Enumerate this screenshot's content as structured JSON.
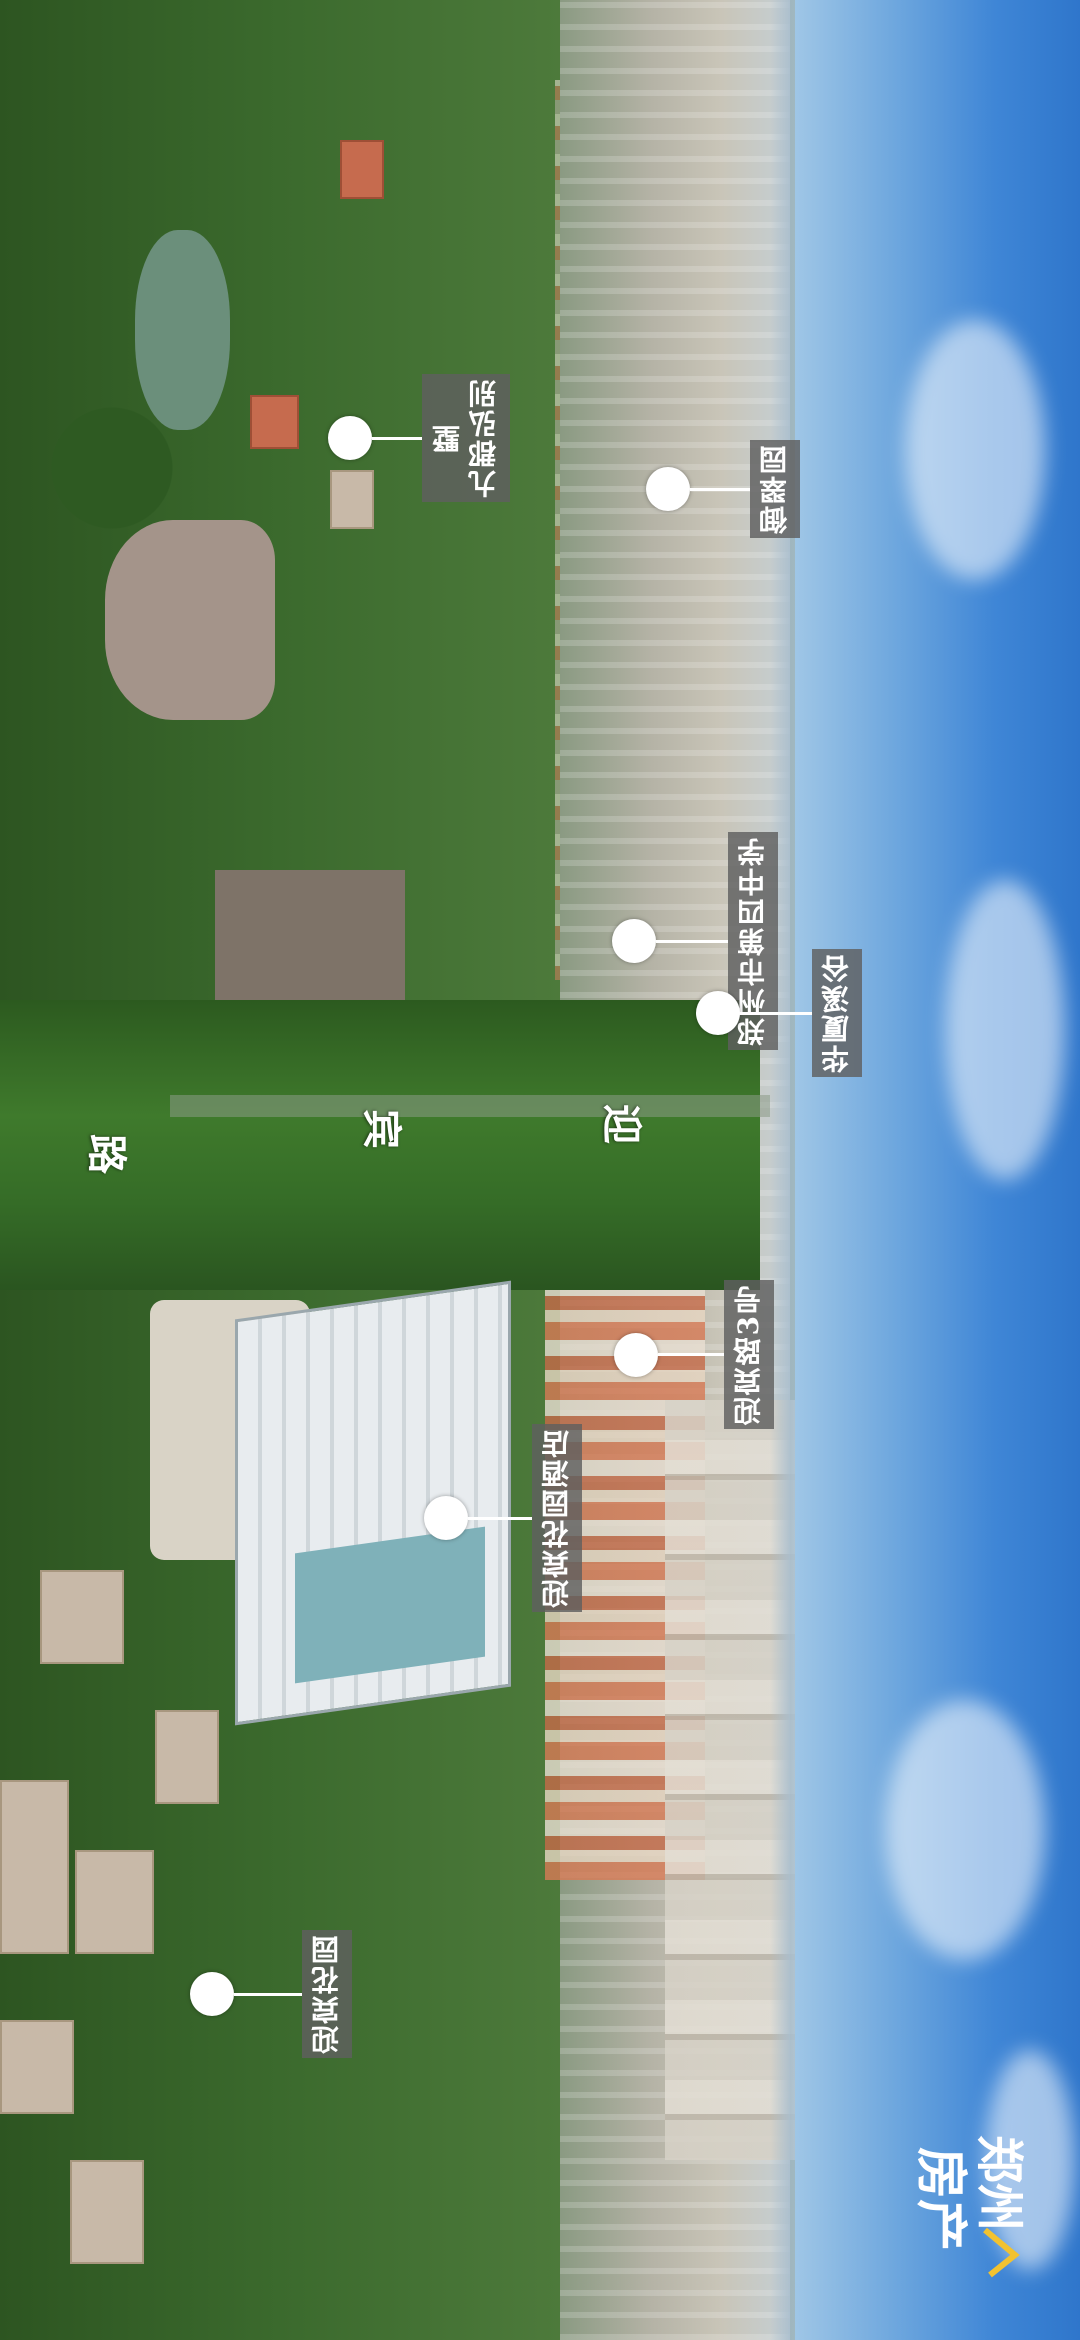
{
  "labels": {
    "yucuiyuan": "御翠园",
    "jiujun_hongbie_1": "九郡弘别",
    "jiujun_hongbie_2": "墅",
    "zhengzhou_4th_school": "郑州市第四中学",
    "huasha_xigu": "华厦溪谷",
    "yingbinlu_3": "迎宾路3号",
    "yingbin_hotel": "迎宾花园酒店",
    "yingbin_garden": "迎宾花园"
  },
  "road_name": {
    "char1": "迎",
    "char2": "宾",
    "char3": "路"
  },
  "logo": {
    "text_top": "郑州",
    "text_bottom": "房产",
    "colors": {
      "primary": "#ffffff",
      "accent": "#f2c230"
    }
  },
  "colors": {
    "tag_bg": "#5f5f5f",
    "sky": "#3f86d6",
    "foliage": "#3b6a2d"
  }
}
